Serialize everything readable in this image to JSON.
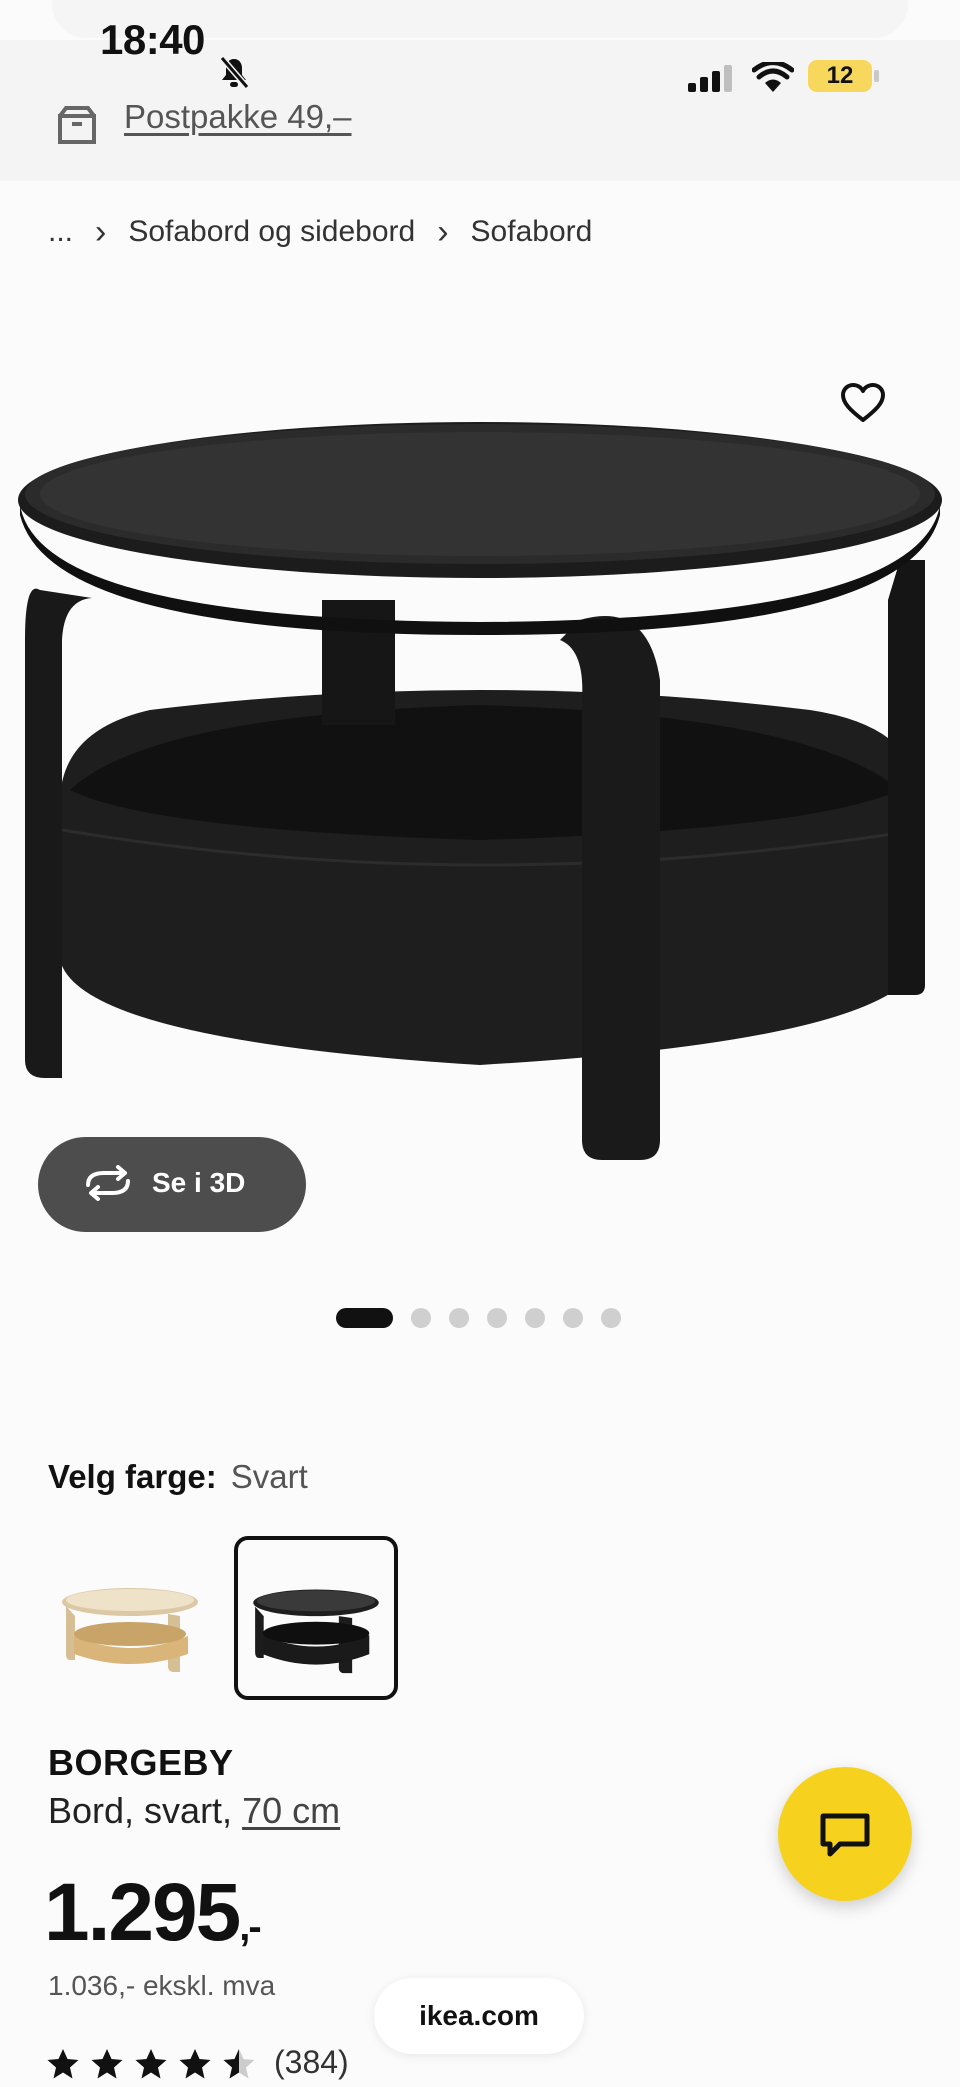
{
  "status_bar": {
    "time": "18:40",
    "battery_level": "12",
    "bell_icon": "bell-slash-icon",
    "signal_icon": "cellular-signal-icon",
    "wifi_icon": "wifi-icon"
  },
  "shipping": {
    "icon": "package-box-icon",
    "label": "Postpakke 49,–"
  },
  "breadcrumb": {
    "ellipsis": "...",
    "items": [
      "Sofabord og sidebord",
      "Sofabord"
    ]
  },
  "gallery": {
    "button_3d": "Se i 3D",
    "slide_count": 7,
    "active_slide": 1
  },
  "color": {
    "label": "Velg farge:",
    "value": "Svart",
    "selected_index": 1
  },
  "product": {
    "name": "BORGEBY",
    "desc_prefix": "Bord, svart, ",
    "size": "70 cm",
    "price": "1.295",
    "price_suffix": ",-",
    "price_ex_vat": "1.036,- ekskl. mva",
    "rating": 4.5,
    "review_count": "(384)"
  },
  "browser": {
    "url": "ikea.com"
  },
  "colors": {
    "accent_yellow": "#F6D21F",
    "dark_button": "#4D4D4D",
    "table_black": "#1E1E1E"
  }
}
